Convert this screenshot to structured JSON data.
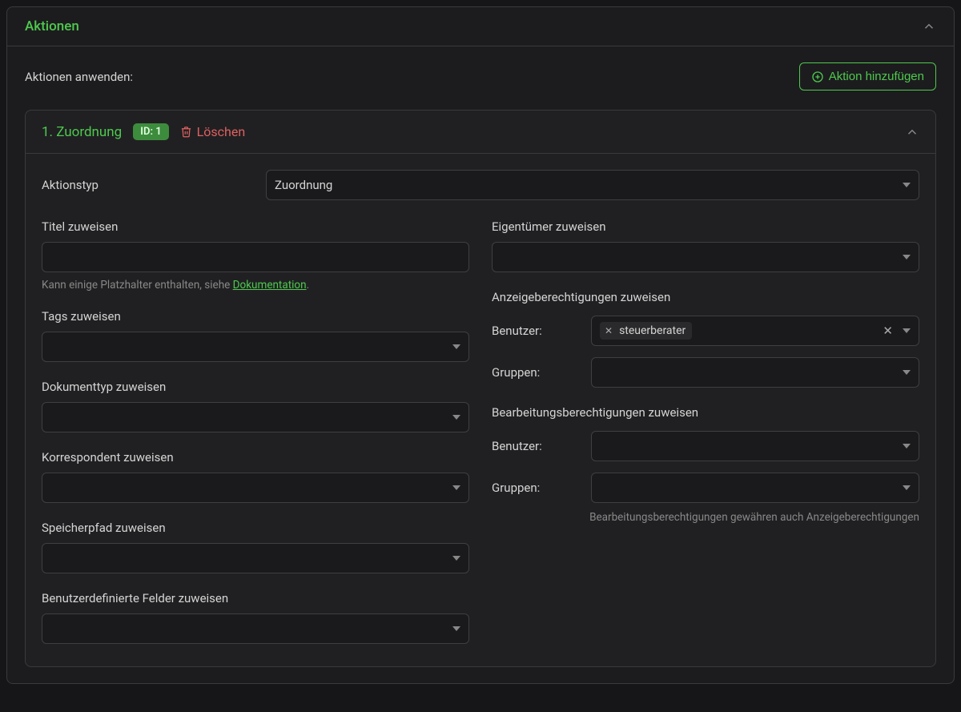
{
  "section": {
    "title": "Aktionen",
    "apply_label": "Aktionen anwenden:",
    "add_button": "Aktion hinzufügen"
  },
  "action": {
    "title": "1. Zuordnung",
    "id_badge": "ID: 1",
    "delete_label": "Löschen",
    "aktionstyp_label": "Aktionstyp",
    "aktionstyp_value": "Zuordnung",
    "left": {
      "titel_label": "Titel zuweisen",
      "titel_value": "",
      "titel_help_text": "Kann einige Platzhalter enthalten, siehe ",
      "titel_help_link": "Dokumentation",
      "titel_help_suffix": ".",
      "tags_label": "Tags zuweisen",
      "dokumenttyp_label": "Dokumenttyp zuweisen",
      "korrespondent_label": "Korrespondent zuweisen",
      "speicherpfad_label": "Speicherpfad zuweisen",
      "custom_fields_label": "Benutzerdefinierte Felder zuweisen"
    },
    "right": {
      "owner_label": "Eigentümer zuweisen",
      "view_perm_label": "Anzeigeberechtigungen zuweisen",
      "edit_perm_label": "Bearbeitungsberechtigungen zuweisen",
      "user_label": "Benutzer:",
      "group_label": "Gruppen:",
      "view_users_tag": "steuerberater",
      "edit_note": "Bearbeitungsberechtigungen gewähren auch Anzeigeberechtigungen"
    }
  }
}
